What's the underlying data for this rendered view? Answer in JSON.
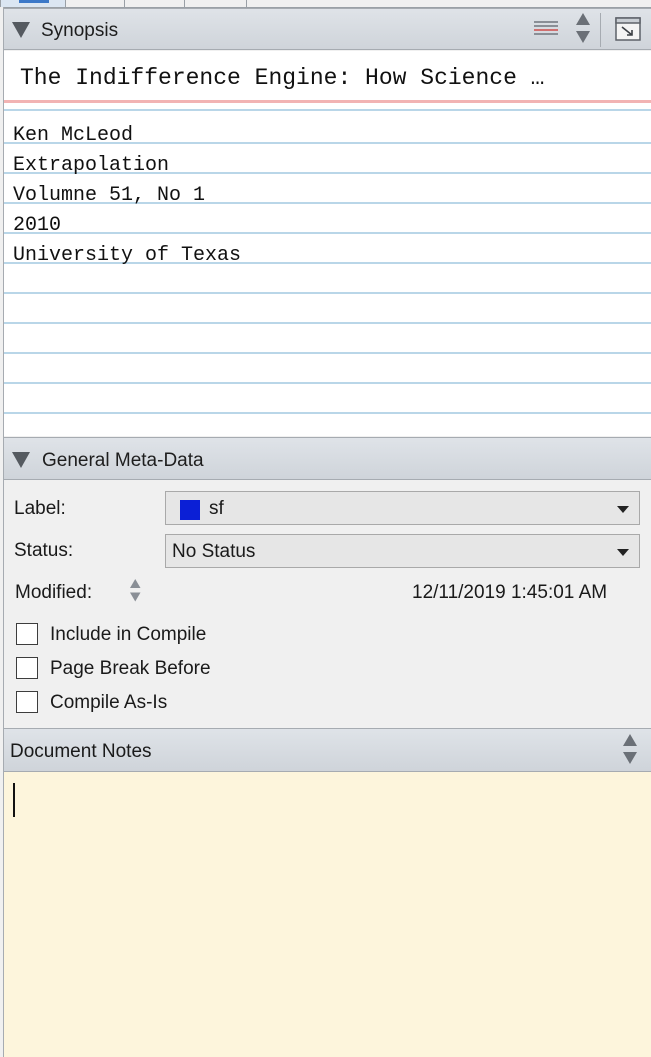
{
  "synopsis": {
    "header_title": "Synopsis",
    "title": "The Indifference Engine: How Science …",
    "lines": [
      "Ken McLeod",
      "Extrapolation",
      "Volumne 51, No 1",
      "2010",
      "University of Texas"
    ]
  },
  "meta": {
    "header_title": "General Meta-Data",
    "label_label": "Label:",
    "label_value": "sf",
    "label_color": "#0b1fd6",
    "status_label": "Status:",
    "status_value": "No Status",
    "modified_label": "Modified:",
    "modified_value": "12/11/2019 1:45:01 AM",
    "checkboxes": [
      {
        "label": "Include in Compile",
        "checked": false
      },
      {
        "label": "Page Break Before",
        "checked": false
      },
      {
        "label": "Compile As-Is",
        "checked": false
      }
    ]
  },
  "notes": {
    "header_title": "Document Notes",
    "value": ""
  },
  "icons": {
    "synopsis_view": "lines-icon",
    "synopsis_sort": "up-down-arrows-icon",
    "expand": "expand-window-icon",
    "collapse": "triangle-down-icon"
  }
}
